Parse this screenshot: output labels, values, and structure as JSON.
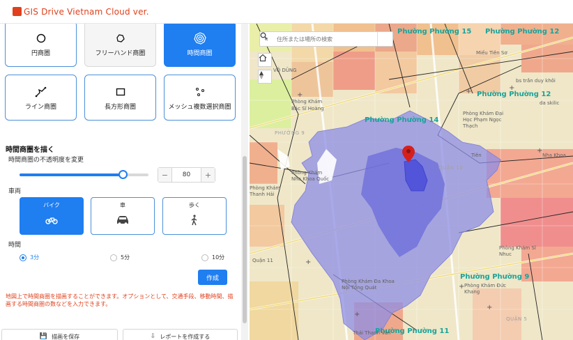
{
  "app": {
    "title": "GIS Drive Vietnam Cloud ver.",
    "brand_color": "#e0401c",
    "accent_color": "#1f7ef0"
  },
  "tools": {
    "circle": "円商圏",
    "freehand": "フリーハンド商圏",
    "time": "時間商圏",
    "line": "ライン商圏",
    "rectangle": "長方形商圏",
    "mesh": "メッシュ複数選択商圏",
    "selected": "時間商圏"
  },
  "time_area": {
    "section_title": "時間商圏を描く",
    "opacity_label": "時間商圏の不透明度を変更",
    "opacity_value": "80",
    "opacity_fraction": 0.8,
    "vehicle_label": "車両",
    "vehicles": [
      "バイク",
      "車",
      "歩く"
    ],
    "selected_vehicle": "バイク",
    "time_label": "時間",
    "time_options": [
      "3分",
      "5分",
      "10分"
    ],
    "selected_time": "3分",
    "create_button": "作成",
    "note": "地図上で時間商圏を描画することができます。オプションとして、交通手段、移動時間、描画する時間商圏の数などを入力できます。"
  },
  "bottom": {
    "save_button": "描画を保存",
    "report_button": "レポートを作成する"
  },
  "map": {
    "search_placeholder": "住所または場所の検索",
    "labels": {
      "phuong15": "Phường Phường 15",
      "phuong12": "Phường Phường 12",
      "phuong12b": "Phường Phường 12",
      "phuong14": "Phường Phường 14",
      "phuong9": "Phường Phường 9",
      "phuong11": "Phường Phường 11",
      "mieu": "Miếu Tiên Sơ",
      "bv": "bs trần duy khôi",
      "phongkham1": "Phòng Khám",
      "bacsi": "Bác Sĩ Hoàng",
      "phuong9small": "PHƯỜNG 9",
      "phongkham2": "Phòng Khám Đại Học Phạm Ngọc Thạch",
      "quan10": "QUẬN 10",
      "quan5": "QUẬN 5",
      "quan11": "Quận 11",
      "thanhhai": "Phòng Khám Thanh Hải",
      "tien": "Tiên",
      "daskilic": "da skilic",
      "vodong": "VÕ DŨNG",
      "khanh": "Phòng Khám Nha Khoa Quốc",
      "tongquat": "Phòng Khám Đa Khoa Nội Tổng Quát",
      "duckhang": "Phòng Khám Đức Khang",
      "vangia": "Thái Thanh Vân",
      "sinhuc": "Phòng Khám Sĩ Nhuc",
      "nha": "Nha Khoa"
    },
    "marker_color": "#d6201c",
    "isochrone_outer_color": "#8e8ee6",
    "isochrone_inner_color": "#4b4fd8"
  }
}
